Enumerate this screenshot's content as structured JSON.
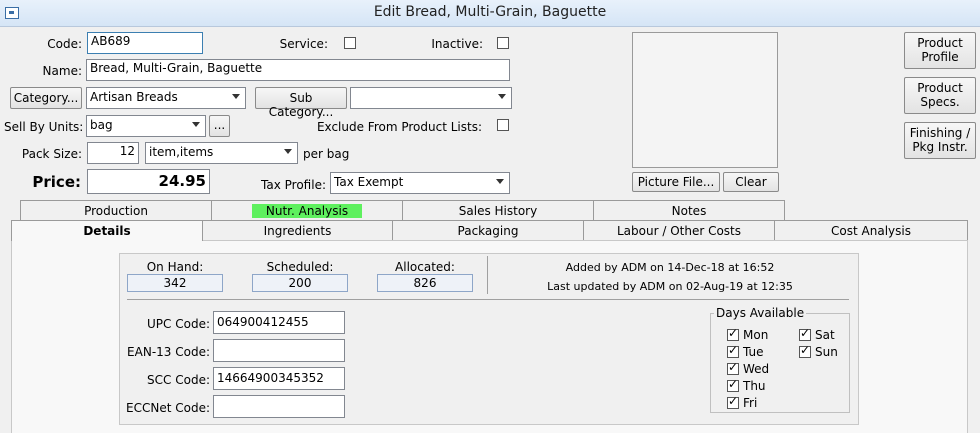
{
  "window": {
    "title": "Edit Bread, Multi-Grain, Baguette"
  },
  "form": {
    "code_label": "Code:",
    "code_value": "AB689",
    "service_label": "Service:",
    "inactive_label": "Inactive:",
    "name_label": "Name:",
    "name_value": "Bread, Multi-Grain, Baguette",
    "category_button": "Category...",
    "category_value": "Artisan Breads",
    "subcategory_button": "Sub Category...",
    "subcategory_value": "",
    "sell_by_label": "Sell By Units:",
    "sell_by_value": "bag",
    "ellipsis_button": "...",
    "exclude_label": "Exclude From Product Lists:",
    "pack_size_label": "Pack Size:",
    "pack_size_value": "12",
    "pack_unit_value": "item,items",
    "per_unit_text": "per bag",
    "price_label": "Price:",
    "price_value": "24.95",
    "tax_profile_label": "Tax Profile:",
    "tax_profile_value": "Tax Exempt",
    "service_checked": false,
    "inactive_checked": false,
    "exclude_checked": false
  },
  "picture": {
    "file_button": "Picture File...",
    "clear_button": "Clear"
  },
  "side_buttons": {
    "product_profile": [
      "Product",
      "Profile"
    ],
    "product_specs": [
      "Product",
      "Specs."
    ],
    "finishing": [
      "Finishing /",
      "Pkg Instr."
    ]
  },
  "tabs": {
    "row1": [
      "Production",
      "Nutr. Analysis",
      "Sales History",
      "Notes"
    ],
    "row2": [
      "Details",
      "Ingredients",
      "Packaging",
      "Labour / Other Costs",
      "Cost Analysis"
    ],
    "active": "Details",
    "highlighted": "Nutr. Analysis",
    "highlight_color": "#5ef05e"
  },
  "details": {
    "on_hand_label": "On Hand:",
    "on_hand_value": "342",
    "scheduled_label": "Scheduled:",
    "scheduled_value": "200",
    "allocated_label": "Allocated:",
    "allocated_value": "826",
    "added_by": "Added by ADM on 14-Dec-18 at 16:52",
    "updated_by": "Last updated by ADM on 02-Aug-19 at 12:35",
    "upc_label": "UPC Code:",
    "upc_value": "064900412455",
    "ean_label": "EAN-13 Code:",
    "ean_value": "",
    "scc_label": "SCC Code:",
    "scc_value": "14664900345352",
    "eccnet_label": "ECCNet Code:",
    "eccnet_value": "",
    "days_title": "Days Available",
    "days": [
      {
        "name": "Mon",
        "checked": true
      },
      {
        "name": "Tue",
        "checked": true
      },
      {
        "name": "Wed",
        "checked": true
      },
      {
        "name": "Thu",
        "checked": true
      },
      {
        "name": "Fri",
        "checked": true
      },
      {
        "name": "Sat",
        "checked": true
      },
      {
        "name": "Sun",
        "checked": true
      }
    ]
  }
}
